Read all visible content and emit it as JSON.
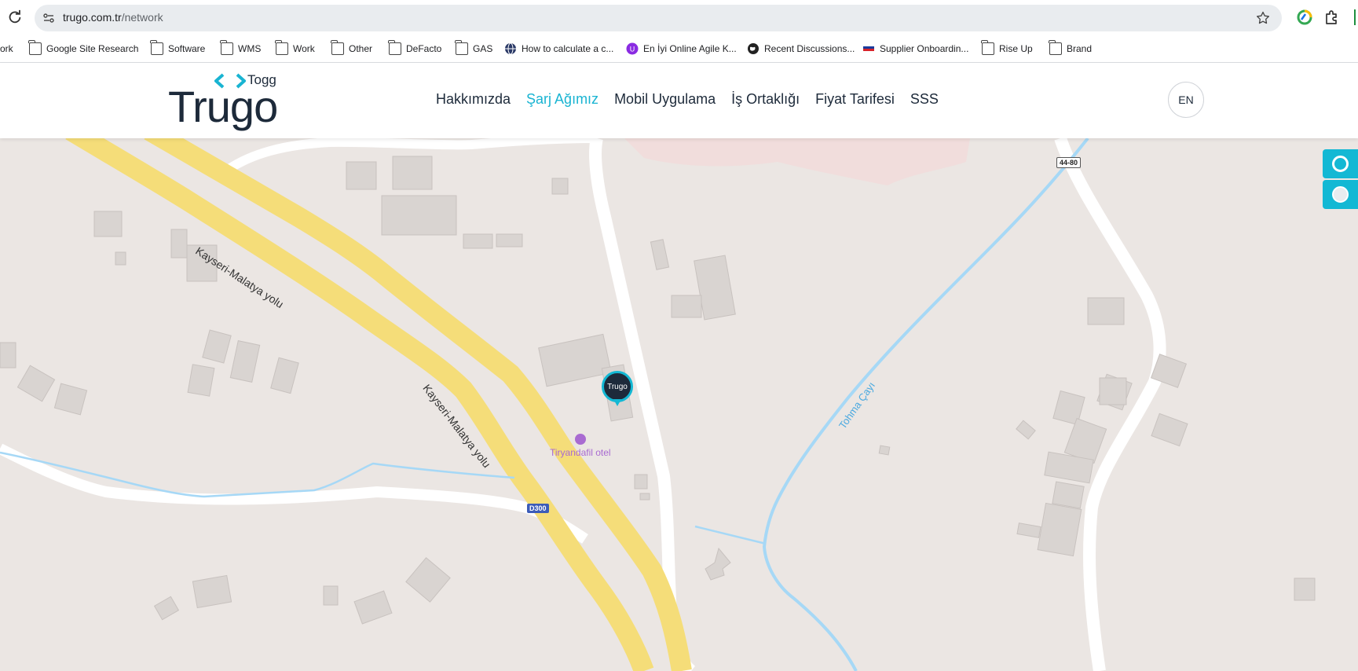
{
  "browser": {
    "url_host": "trugo.com.tr",
    "url_path": "/network",
    "bookmarks": [
      {
        "label": "ork",
        "icon": "folder-icon"
      },
      {
        "label": "Google Site Research",
        "icon": "folder-icon"
      },
      {
        "label": "Software",
        "icon": "folder-icon"
      },
      {
        "label": "WMS",
        "icon": "folder-icon"
      },
      {
        "label": "Work",
        "icon": "folder-icon"
      },
      {
        "label": "Other",
        "icon": "folder-icon"
      },
      {
        "label": "DeFacto",
        "icon": "folder-icon"
      },
      {
        "label": "GAS",
        "icon": "folder-icon"
      },
      {
        "label": "How to calculate a c...",
        "icon": "globe-icon"
      },
      {
        "label": "En İyi Online Agile K...",
        "icon": "site-icon"
      },
      {
        "label": "Recent Discussions...",
        "icon": "globe-icon"
      },
      {
        "label": "Supplier Onboardin...",
        "icon": "flag-icon"
      },
      {
        "label": "Rise Up",
        "icon": "folder-icon"
      },
      {
        "label": "Brand",
        "icon": "folder-icon"
      }
    ]
  },
  "site": {
    "logo_main": "Trugo",
    "logo_sub": "Togg",
    "nav": [
      {
        "label": "Hakkımızda",
        "active": false
      },
      {
        "label": "Şarj Ağımız",
        "active": true
      },
      {
        "label": "Mobil Uygulama",
        "active": false
      },
      {
        "label": "İş Ortaklığı",
        "active": false
      },
      {
        "label": "Fiyat Tarifesi",
        "active": false
      },
      {
        "label": "SSS",
        "active": false
      }
    ],
    "lang_button": "EN",
    "accent_color": "#19b4d2"
  },
  "map": {
    "road_labels": {
      "road_1": "Kayseri-Malatya yolu",
      "road_2": "Kayseri-Malatya yolu",
      "river": "Tohma Çayı"
    },
    "shields": {
      "d300": "D300",
      "route_4480": "44-80"
    },
    "poi_label": "Tiryandafil otel",
    "marker_text": "Trugo"
  }
}
